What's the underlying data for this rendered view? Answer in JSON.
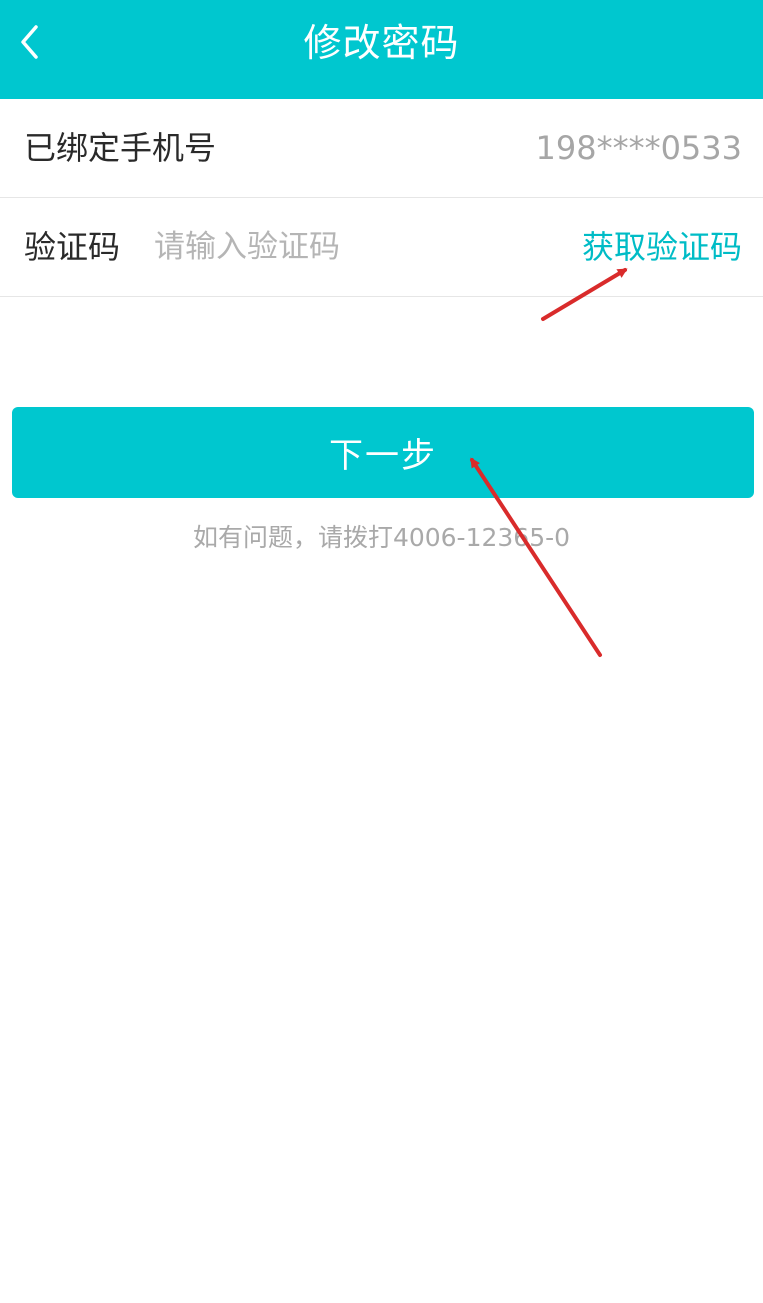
{
  "header": {
    "title": "修改密码",
    "back_icon": "chevron-left-icon"
  },
  "phone_row": {
    "label": "已绑定手机号",
    "value": "198****0533"
  },
  "code_row": {
    "label": "验证码",
    "input_value": "",
    "placeholder": "请输入验证码",
    "get_code_label": "获取验证码"
  },
  "next_button": {
    "label": "下一步"
  },
  "help_text": "如有问题，请拨打4006-12365-0",
  "colors": {
    "primary": "#00C7CF",
    "link": "#00BCC6",
    "annotation_arrow": "#D92B2B"
  }
}
